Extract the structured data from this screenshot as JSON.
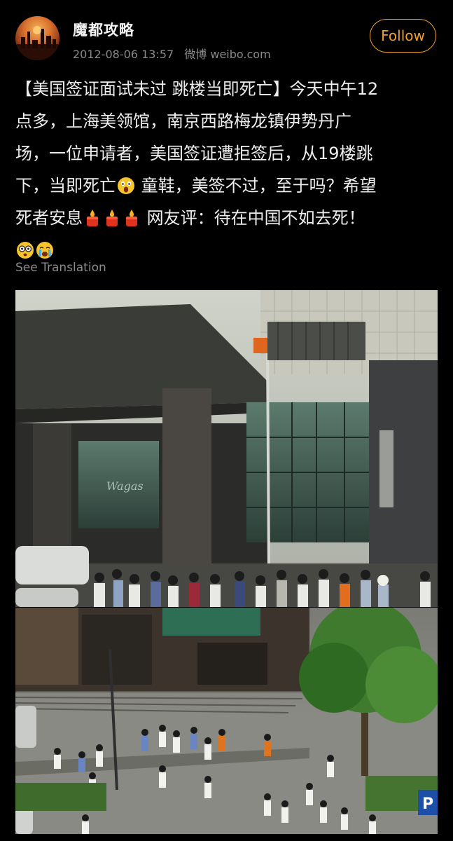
{
  "post": {
    "username": "魔都攻略",
    "timestamp": "2012-08-06 13:57",
    "source": "微博 weibo.com",
    "follow_label": "Follow",
    "text_lines": [
      "【美国签证面试未过 跳楼当即死亡】今天中午12",
      "点多，上海美领馆，南京西路梅龙镇伊势丹广",
      "场，一位申请者，美国签证遭拒签后，从19楼跳",
      "下，当即死亡",
      " 童鞋，美签不过，至于吗？希望",
      "死者安息",
      " 网友评：待在中国不如去死！"
    ],
    "emojis": {
      "shocked": "shocked-face-emoji",
      "candles": [
        "candle-emoji",
        "candle-emoji",
        "candle-emoji"
      ],
      "end": [
        "dizzy-face-emoji",
        "crying-face-emoji"
      ]
    },
    "see_translation": "See Translation",
    "images": [
      {
        "name": "building-entrance-photo",
        "sign": "Wagas"
      },
      {
        "name": "plaza-overhead-photo",
        "sign": "P"
      }
    ]
  },
  "colors": {
    "background": "#000000",
    "text": "#ededed",
    "meta": "#8a8a8a",
    "accent": "#f0a028"
  }
}
